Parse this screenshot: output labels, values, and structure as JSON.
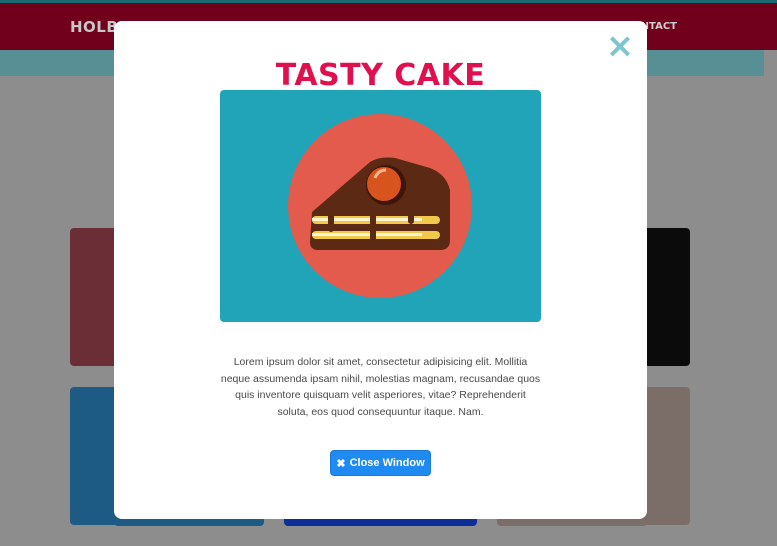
{
  "background_page": {
    "brand": "HOLBERTON ME",
    "nav_link": "CONTACT"
  },
  "modal": {
    "title": "TASTY CAKE",
    "close_icon": "×",
    "illustration": "cake-slice-icon",
    "body": "Lorem ipsum dolor sit amet, consectetur adipisicing elit. Mollitia neque assumenda ipsam nihil, molestias magnam, recusandae quos quis inventore quisquam velit asperiores, vitae? Reprehenderit soluta, eos quod consequuntur itaque. Nam.",
    "close_button": {
      "icon": "✖",
      "label": "Close Window"
    }
  },
  "colors": {
    "title": "#e0104f",
    "illustration_bg": "#21a3b8",
    "plate": "#e25b4c",
    "button": "#1f8bf2",
    "close_x": "#7ec6cf"
  }
}
